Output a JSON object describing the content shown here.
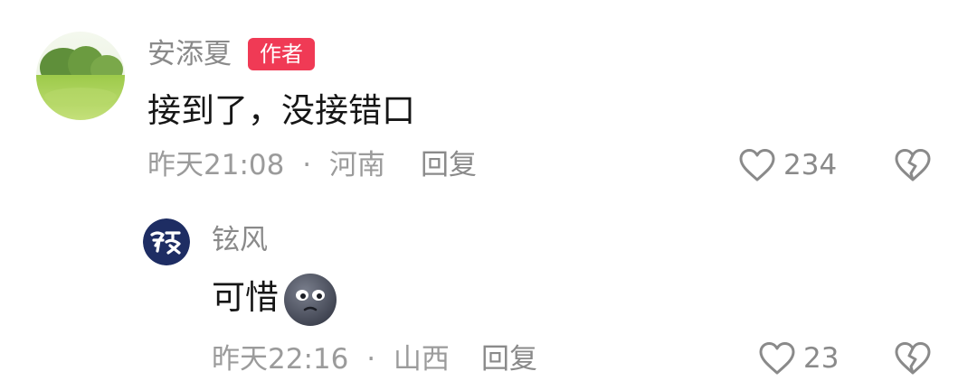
{
  "colors": {
    "badge_bg": "#f03a55",
    "muted_text": "#8a8a8a",
    "body_text": "#161616",
    "reply_avatar_bg": "#1e2d63"
  },
  "comment": {
    "username": "安添夏",
    "badge": "作者",
    "text": "接到了，没接错口",
    "time": "昨天21:08",
    "separator": "·",
    "location": "河南",
    "reply_label": "回复",
    "like_count": "234",
    "avatar_icon": "grass-field-avatar",
    "like_icon": "heart-outline-icon",
    "dislike_icon": "broken-heart-icon"
  },
  "reply": {
    "username": "铉风",
    "avatar_icon": "logo-avatar",
    "text": "可惜",
    "emoji": "dark-face-emoji",
    "time": "昨天22:16",
    "separator": "·",
    "location": "山西",
    "reply_label": "回复",
    "like_count": "23",
    "like_icon": "heart-outline-icon",
    "dislike_icon": "broken-heart-icon"
  }
}
